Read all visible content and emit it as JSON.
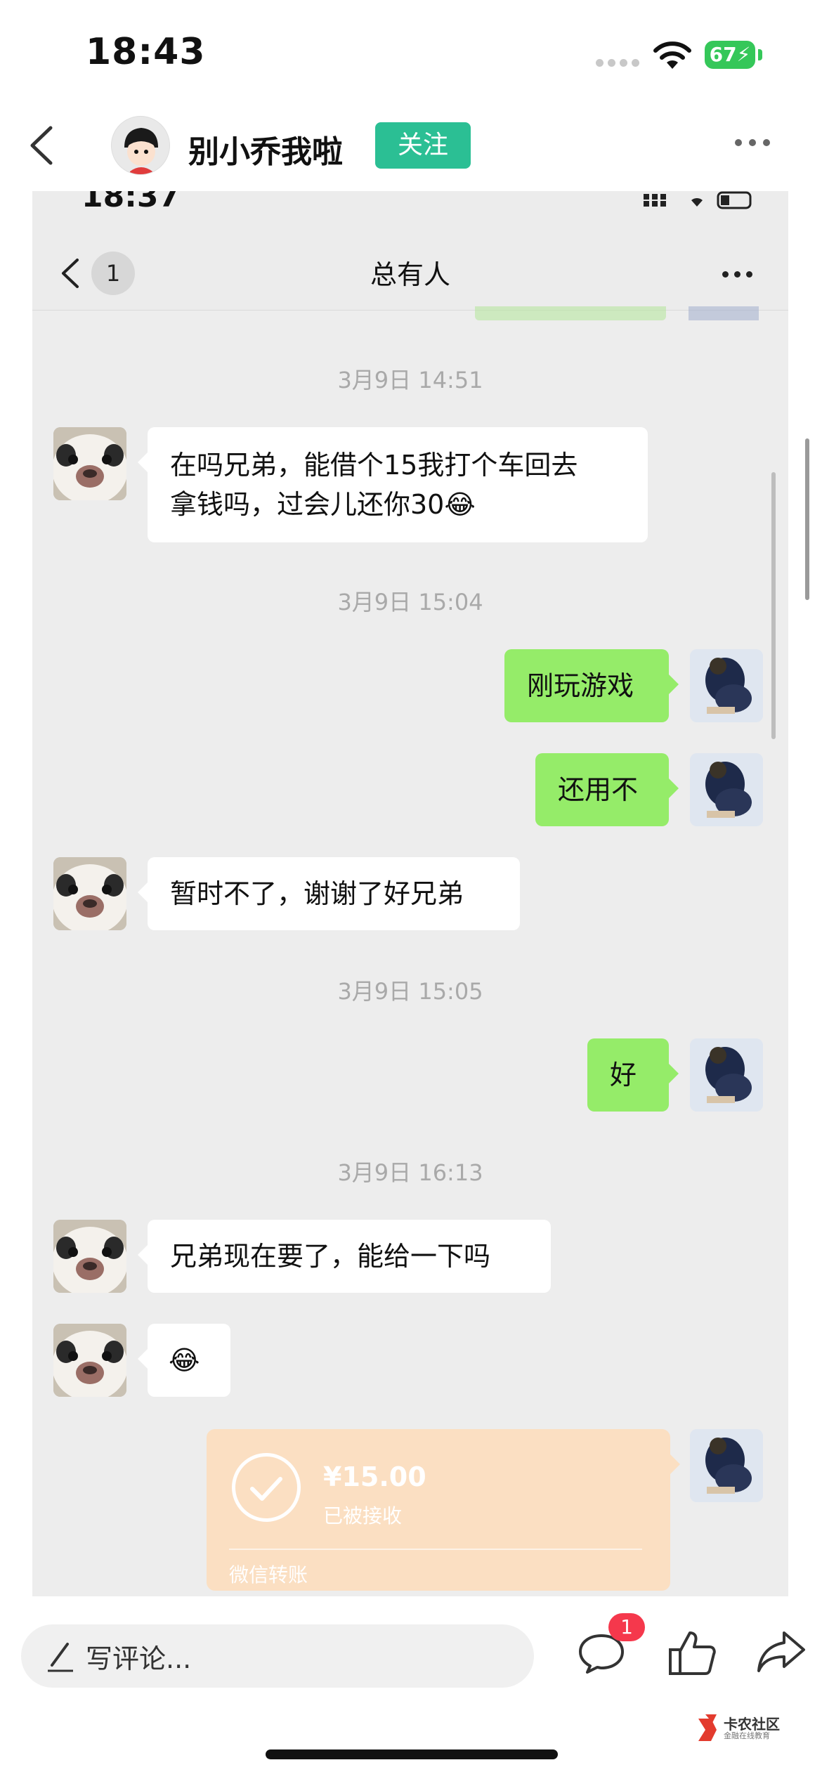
{
  "status_bar": {
    "time": "18:43",
    "battery": "67"
  },
  "post": {
    "author": "别小乔我啦",
    "follow_label": "关注"
  },
  "screenshot": {
    "status_time": "18:37",
    "nav": {
      "back_badge": "1",
      "title": "总有人"
    },
    "messages": [
      {
        "type": "time",
        "text": "3月9日 14:51"
      },
      {
        "type": "in",
        "lines": [
          "在吗兄弟，能借个15我打个车回去",
          "拿钱吗，过会儿还你30"
        ],
        "emoji": "😂"
      },
      {
        "type": "time",
        "text": "3月9日 15:04"
      },
      {
        "type": "out",
        "text": "刚玩游戏"
      },
      {
        "type": "out",
        "text": "还用不"
      },
      {
        "type": "in",
        "text": "暂时不了，谢谢了好兄弟"
      },
      {
        "type": "time",
        "text": "3月9日 15:05"
      },
      {
        "type": "out",
        "text": "好"
      },
      {
        "type": "time",
        "text": "3月9日 16:13"
      },
      {
        "type": "in",
        "text": "兄弟现在要了，能给一下吗"
      },
      {
        "type": "in",
        "emoji": "😂"
      },
      {
        "type": "transfer",
        "amount": "¥15.00",
        "status": "已被接收",
        "label": "微信转账"
      }
    ]
  },
  "bottom_bar": {
    "comment_placeholder": "写评论...",
    "comment_count": "1"
  },
  "watermark": {
    "title": "卡农社区",
    "subtitle": "金融在线教育"
  },
  "colors": {
    "follow": "#2bbf94",
    "outgoing_bubble": "#95ec69",
    "transfer": "#fbdfc2",
    "badge": "#f5384c",
    "battery": "#35c759"
  }
}
